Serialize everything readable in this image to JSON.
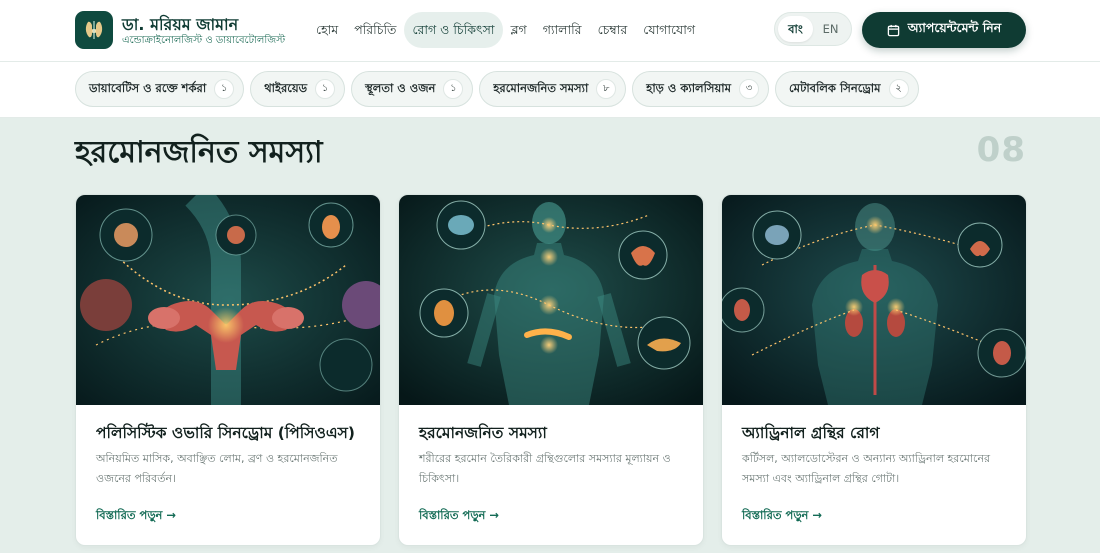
{
  "brand": {
    "name": "ডা. মরিয়ম জামান",
    "subtitle": "এন্ডোক্রাইনোলজিস্ট ও ডায়াবেটোলজিস্ট",
    "logo_icon": "thyroid-logo-icon"
  },
  "nav": {
    "items": [
      {
        "label": "হোম"
      },
      {
        "label": "পরিচিতি"
      },
      {
        "label": "রোগ ও চিকিৎসা"
      },
      {
        "label": "ব্লগ"
      },
      {
        "label": "গ্যালারি"
      },
      {
        "label": "চেম্বার"
      },
      {
        "label": "যোগাযোগ"
      }
    ],
    "active_index": 2
  },
  "language": {
    "options": [
      "বাং",
      "EN"
    ],
    "active": "বাং"
  },
  "cta": {
    "label": "অ্যাপয়েন্টমেন্ট নিন",
    "icon": "calendar-icon"
  },
  "categories": [
    {
      "label": "ডায়াবেটিস ও রক্তে শর্করা",
      "count": "১"
    },
    {
      "label": "থাইরয়েড",
      "count": "১"
    },
    {
      "label": "স্থূলতা ও ওজন",
      "count": "১"
    },
    {
      "label": "হরমোনজনিত সমস্যা",
      "count": "৮"
    },
    {
      "label": "হাড় ও ক্যালসিয়াম",
      "count": "৩"
    },
    {
      "label": "মেটাবলিক সিনড্রোম",
      "count": "২"
    }
  ],
  "section": {
    "title": "হরমোনজনিত সমস্যা",
    "number": "08"
  },
  "cards": [
    {
      "title": "পলিসিস্টিক ওভারি সিনড্রোম (পিসিওএস)",
      "description": "অনিয়মিত মাসিক, অবাঞ্ছিত লোম, ব্রণ ও হরমোনজনিত ওজনের পরিবর্তন।",
      "link": "বিস্তারিত পড়ুন →"
    },
    {
      "title": "হরমোনজনিত সমস্যা",
      "description": "শরীরের হরমোন তৈরিকারী গ্রন্থিগুলোর সমস্যার মূল্যায়ন ও চিকিৎসা।",
      "link": "বিস্তারিত পড়ুন →"
    },
    {
      "title": "অ্যাড্রিনাল গ্রন্থির রোগ",
      "description": "কর্টিসল, অ্যালডোস্টেরন ও অন্যান্য অ্যাড্রিনাল হরমোনের সমস্যা এবং অ্যাড্রিনাল গ্রন্থির গোটা।",
      "link": "বিস্তারিত পড়ুন →"
    }
  ],
  "colors": {
    "brand_dark": "#0f3b33",
    "accent_green": "#136b55",
    "page_bg": "#e4eeea"
  }
}
